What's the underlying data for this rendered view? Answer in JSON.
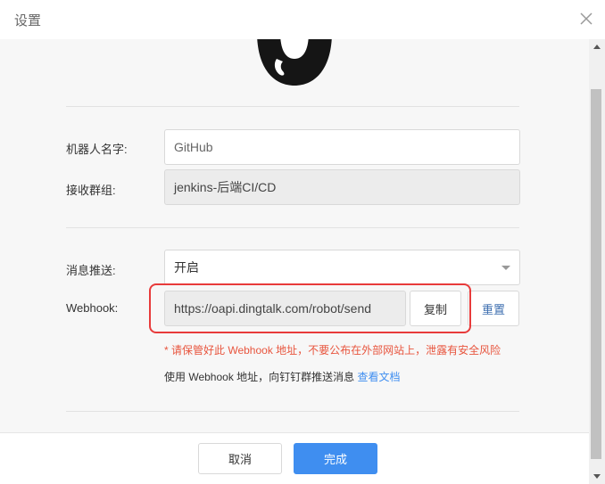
{
  "dialog": {
    "title": "设置",
    "close_icon": "close-icon"
  },
  "form": {
    "robot_name_label": "机器人名字:",
    "robot_name_value": "GitHub",
    "group_label": "接收群组:",
    "group_value": "jenkins-后端CI/CD",
    "push_label": "消息推送:",
    "push_value": "开启",
    "webhook_label": "Webhook:",
    "webhook_value": "https://oapi.dingtalk.com/robot/send",
    "copy_label": "复制",
    "reset_label": "重置",
    "warning_text": "* 请保管好此 Webhook 地址，不要公布在外部网站上，泄露有安全风险",
    "usage_text": "使用 Webhook 地址，向钉钉群推送消息",
    "doc_link_text": "查看文档"
  },
  "footer": {
    "cancel_label": "取消",
    "done_label": "完成"
  },
  "colors": {
    "primary": "#3f8ef0",
    "warning": "#e8553e",
    "highlight": "#e83b3b"
  }
}
